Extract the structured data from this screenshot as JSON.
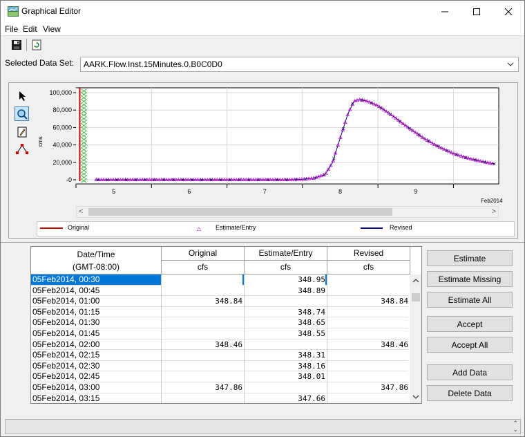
{
  "window": {
    "title": "Graphical Editor"
  },
  "menu": {
    "file": "File",
    "edit": "Edit",
    "view": "View"
  },
  "toolbar": {
    "save_icon": "floppy-disk-icon",
    "refresh_icon": "refresh-icon"
  },
  "dataset": {
    "label": "Selected Data Set:",
    "value": "AARK.Flow.Inst.15Minutes.0.B0C0D0"
  },
  "plot_tools": [
    "pointer-icon",
    "zoom-icon",
    "edit-pencil-icon",
    "draw-line-icon"
  ],
  "chart_data": {
    "type": "scatter",
    "ylabel": "cms",
    "y_ticks": [
      "100,000",
      "80,000",
      "60,000",
      "40,000",
      "20,000",
      "-0"
    ],
    "ylim": [
      0,
      100000
    ],
    "x_ticks": [
      "5",
      "6",
      "7",
      "8",
      "9"
    ],
    "x_period_label": "Feb2014",
    "series": [
      {
        "name": "Original",
        "color": "#cc0000"
      },
      {
        "name": "Estimate/Entry",
        "color": "#cc00cc"
      },
      {
        "name": "Revised",
        "color": "#00008b"
      }
    ],
    "x": [
      4.75,
      5.0,
      5.5,
      6.0,
      6.5,
      7.0,
      7.3,
      7.5,
      7.65,
      7.8,
      7.9,
      8.0,
      8.1,
      8.18,
      8.25,
      8.35,
      8.5,
      8.7,
      8.9,
      9.1,
      9.3,
      9.5,
      9.7,
      9.9,
      10.05
    ],
    "y": [
      0,
      0,
      0,
      0,
      0,
      0,
      0,
      500,
      1800,
      6000,
      20000,
      48000,
      75000,
      90000,
      92000,
      90500,
      85000,
      73000,
      60000,
      48000,
      38000,
      30000,
      24500,
      20500,
      18000
    ]
  },
  "legend": {
    "original": "Original",
    "estimate": "Estimate/Entry",
    "revised": "Revised"
  },
  "table": {
    "headers": {
      "datetime": "Date/Time",
      "timezone": "(GMT-08:00)",
      "original": "Original",
      "estimate": "Estimate/Entry",
      "revised": "Revised",
      "unit": "cfs"
    },
    "rows": [
      {
        "date": "05Feb2014, 00:30",
        "original": "",
        "estimate": "348.95",
        "revised": ""
      },
      {
        "date": "05Feb2014, 00:45",
        "original": "",
        "estimate": "348.89",
        "revised": ""
      },
      {
        "date": "05Feb2014, 01:00",
        "original": "348.84",
        "estimate": "",
        "revised": "348.84"
      },
      {
        "date": "05Feb2014, 01:15",
        "original": "",
        "estimate": "348.74",
        "revised": ""
      },
      {
        "date": "05Feb2014, 01:30",
        "original": "",
        "estimate": "348.65",
        "revised": ""
      },
      {
        "date": "05Feb2014, 01:45",
        "original": "",
        "estimate": "348.55",
        "revised": ""
      },
      {
        "date": "05Feb2014, 02:00",
        "original": "348.46",
        "estimate": "",
        "revised": "348.46"
      },
      {
        "date": "05Feb2014, 02:15",
        "original": "",
        "estimate": "348.31",
        "revised": ""
      },
      {
        "date": "05Feb2014, 02:30",
        "original": "",
        "estimate": "348.16",
        "revised": ""
      },
      {
        "date": "05Feb2014, 02:45",
        "original": "",
        "estimate": "348.01",
        "revised": ""
      },
      {
        "date": "05Feb2014, 03:00",
        "original": "347.86",
        "estimate": "",
        "revised": "347.86"
      },
      {
        "date": "05Feb2014, 03:15",
        "original": "",
        "estimate": "347.66",
        "revised": ""
      }
    ]
  },
  "buttons": {
    "estimate": "Estimate",
    "estimate_missing": "Estimate Missing",
    "estimate_all": "Estimate All",
    "accept": "Accept",
    "accept_all": "Accept All",
    "add_data": "Add Data",
    "delete_data": "Delete Data"
  },
  "status": {
    "text": ""
  }
}
